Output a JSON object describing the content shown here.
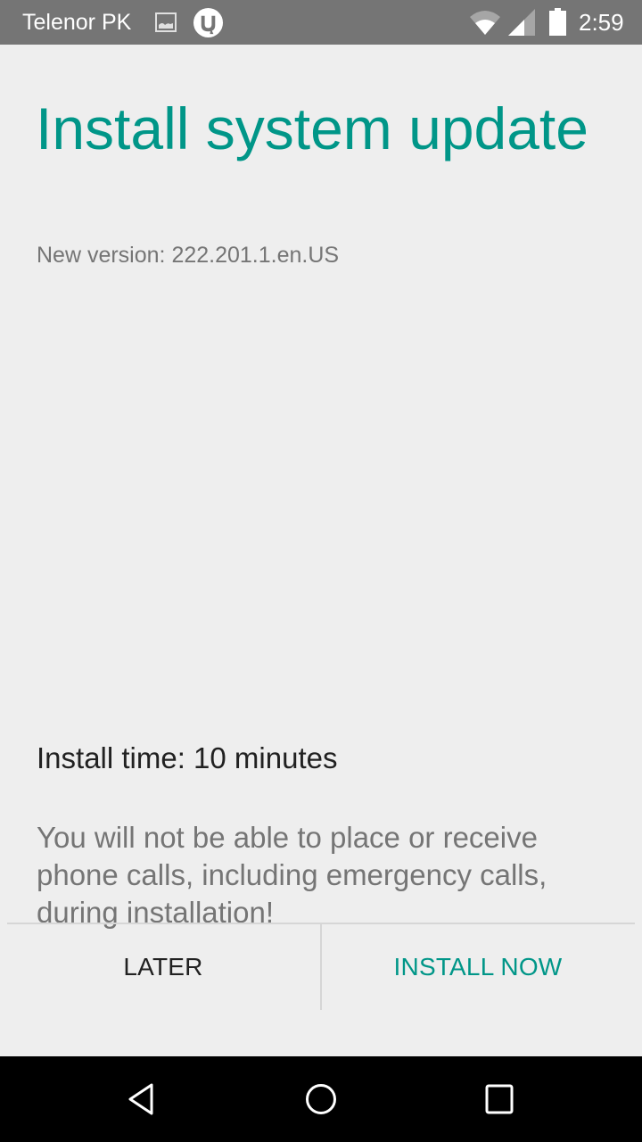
{
  "status_bar": {
    "carrier": "Telenor PK",
    "notification_icons": [
      "image-icon",
      "utorrent-icon"
    ],
    "system_icons": [
      "wifi-icon",
      "cell-signal-icon",
      "battery-icon"
    ],
    "time": "2:59"
  },
  "dialog": {
    "title": "Install system update",
    "version": "New version: 222.201.1.en.US",
    "install_time": "Install time: 10 minutes",
    "warning": "You will not be able to place or receive phone calls, including emergency calls, during installation!",
    "accent_color": "#009688"
  },
  "actions": {
    "later_label": "LATER",
    "install_now_label": "INSTALL NOW"
  },
  "nav_bar": {
    "buttons": [
      "back",
      "home",
      "recents"
    ]
  }
}
